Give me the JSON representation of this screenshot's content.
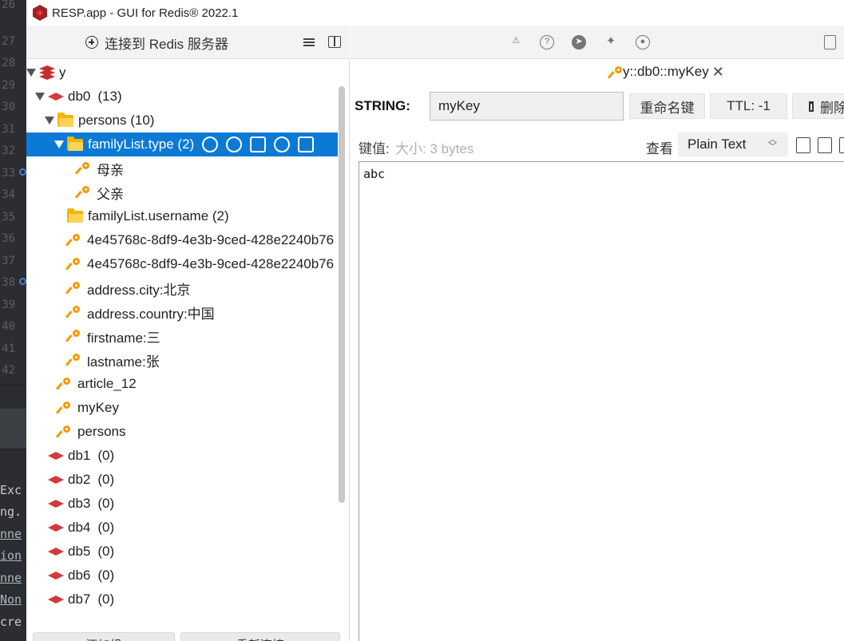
{
  "window": {
    "title": "RESP.app - GUI for Redis® 2022.1"
  },
  "gutter": {
    "line_numbers": [
      "26",
      "27",
      "28",
      "29",
      "30",
      "31",
      "32",
      "33",
      "34",
      "35",
      "36",
      "37",
      "38",
      "39",
      "40",
      "41",
      "42"
    ],
    "console_lines": [
      "Exc",
      "ng.",
      "nne",
      "ion",
      "nne",
      "Non",
      "cre"
    ]
  },
  "left": {
    "connect_label": "连接到 Redis 服务器",
    "bottom_buttons": [
      "添加组",
      "重新连接"
    ]
  },
  "tree": {
    "root": "y",
    "db0": {
      "name": "db0",
      "count": "(13)"
    },
    "persons_folder": "persons (10)",
    "familylist_type": "familyList.type (2)",
    "mother": "母亲",
    "father": "父亲",
    "familylist_username": "familyList.username (2)",
    "uuid1": "4e45768c-8df9-4e3b-9ced-428e2240b76",
    "uuid2": "4e45768c-8df9-4e3b-9ced-428e2240b76",
    "address_city": "address.city:北京",
    "address_country": "address.country:中国",
    "firstname": "firstname:三",
    "lastname": "lastname:张",
    "article": "article_12",
    "mykey": "myKey",
    "persons_key": "persons",
    "dbs": [
      {
        "name": "db1",
        "count": "(0)"
      },
      {
        "name": "db2",
        "count": "(0)"
      },
      {
        "name": "db3",
        "count": "(0)"
      },
      {
        "name": "db4",
        "count": "(0)"
      },
      {
        "name": "db5",
        "count": "(0)"
      },
      {
        "name": "db6",
        "count": "(0)"
      },
      {
        "name": "db7",
        "count": "(0)"
      }
    ]
  },
  "right": {
    "tab_label": "y::db0::myKey",
    "type_label": "STRING:",
    "key_name": "myKey",
    "rename_label": "重命名键",
    "ttl_label": "TTL: -1",
    "delete_label": "删除",
    "value_label": "键值:",
    "size_label": "大小: 3 bytes",
    "view_label": "查看",
    "view_mode": "Plain Text",
    "value": "abc"
  }
}
